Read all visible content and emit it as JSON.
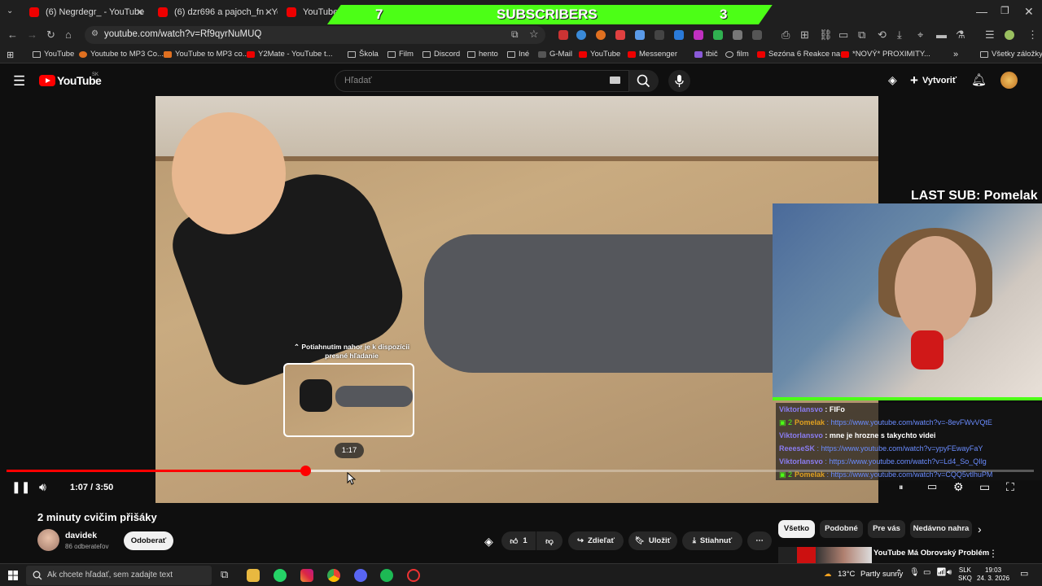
{
  "browser": {
    "tabs": [
      {
        "label": "(6) Negrdegr_ - YouTube"
      },
      {
        "label": "(6) dzr696 a pajoch_fn - YouTu"
      },
      {
        "label": "YouTuberi, Ktorých"
      }
    ],
    "url": "youtube.com/watch?v=Rf9qyrNuMUQ",
    "bookmarks": [
      "YouTube",
      "Youtube to MP3 Co...",
      "YouTube to MP3 co...",
      "Y2Mate - YouTube t...",
      "Škola",
      "Film",
      "Discord",
      "hento",
      "Iné",
      "G-Mail",
      "YouTube",
      "Messenger",
      "tbič",
      "film",
      "Sezóna 6 Reakce na...",
      "*NOVÝ* PROXIMITY..."
    ],
    "all_bookmarks": "Všetky záložky"
  },
  "stream_overlay": {
    "left_count": "7",
    "label": "SUBSCRIBERS",
    "right_count": "3",
    "last_sub": "LAST SUB: Pomelak",
    "chat": [
      {
        "name": "Viktorlansvo",
        "text": ": FIFo",
        "link": false,
        "badge": ""
      },
      {
        "name": "Pomelak",
        "text": ": https://www.youtube.com/watch?v=-8evFWvVQtE",
        "link": true,
        "badge": "2"
      },
      {
        "name": "Viktorlansvo",
        "text": ": mne je hrozne s takychto videi",
        "link": false,
        "badge": ""
      },
      {
        "name": "ReeeseSK",
        "text": ": https://www.youtube.com/watch?v=ypyFEwayFaY",
        "link": true,
        "badge": ""
      },
      {
        "name": "Viktorlansvo",
        "text": ": https://www.youtube.com/watch?v=Ld4_So_QIlg",
        "link": true,
        "badge": ""
      },
      {
        "name": "Pomelak",
        "text": ": https://www.youtube.com/watch?v=CQQ5vtlhuPM",
        "link": true,
        "badge": "2"
      }
    ]
  },
  "youtube": {
    "logo_text": "YouTube",
    "logo_region": "SK",
    "search_placeholder": "Hľadať",
    "create_label": "Vytvoriť"
  },
  "player": {
    "current_time": "1:07",
    "duration": "3:50",
    "time_sep": " / ",
    "played_fraction": 0.291,
    "buffered_fraction": 0.364,
    "hover_time": "1:17",
    "seek_hint": "Potiahnutím nahor je k dispozícii presné hľadanie"
  },
  "video": {
    "title": "2 minuty cvičim přišáky",
    "channel": "davidek",
    "subscribers": "86 odberateľov",
    "unsubscribe_label": "Odoberať",
    "likes": "1",
    "share_label": "Zdieľať",
    "save_label": "Uložiť",
    "download_label": "Stiahnuť"
  },
  "sidebar": {
    "chips": [
      "Všetko",
      "Podobné",
      "Pre vás",
      "Nedávno nahra"
    ],
    "rec_title": "YouTube Má Obrovský Problém"
  },
  "taskbar": {
    "search_placeholder": "Ak chcete hľadať, sem zadajte text",
    "temperature": "13°C",
    "weather": "Partly sunny",
    "lang_top": "SLK",
    "lang_bottom": "SKQ",
    "time": "19:03",
    "date": "24. 3. 2026"
  },
  "colors": {
    "accent_red": "#ff0000",
    "overlay_green": "#4cff16"
  }
}
